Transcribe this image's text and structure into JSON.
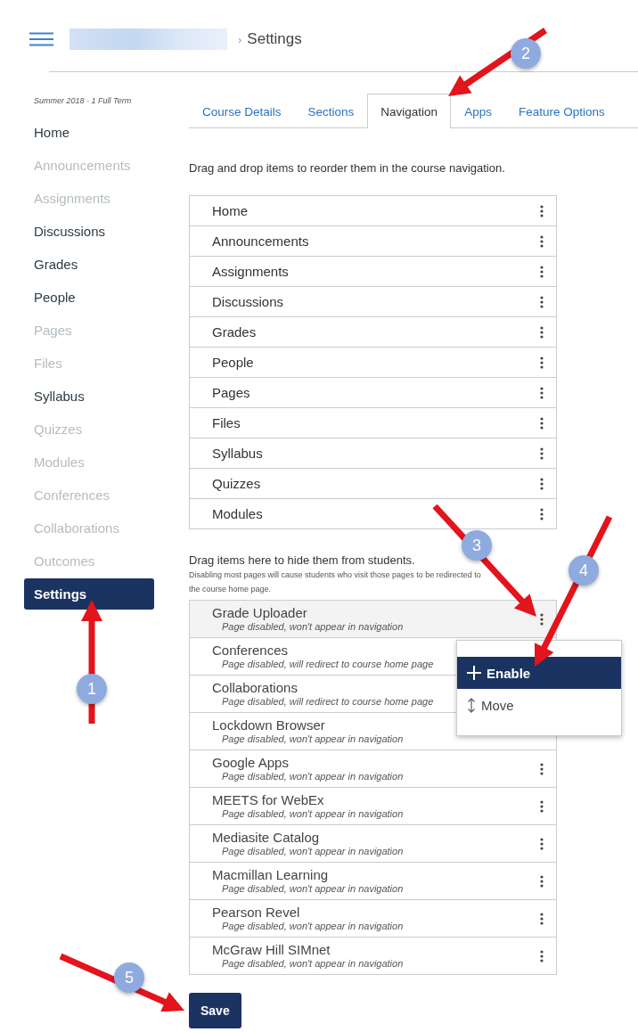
{
  "header": {
    "breadcrumb_separator": "›",
    "title": "Settings"
  },
  "sidebar": {
    "term": "Summer 2018 - 1 Full Term",
    "items": [
      {
        "label": "Home",
        "disabled": false,
        "selected": false
      },
      {
        "label": "Announcements",
        "disabled": true,
        "selected": false
      },
      {
        "label": "Assignments",
        "disabled": true,
        "selected": false
      },
      {
        "label": "Discussions",
        "disabled": false,
        "selected": false
      },
      {
        "label": "Grades",
        "disabled": false,
        "selected": false
      },
      {
        "label": "People",
        "disabled": false,
        "selected": false
      },
      {
        "label": "Pages",
        "disabled": true,
        "selected": false
      },
      {
        "label": "Files",
        "disabled": true,
        "selected": false
      },
      {
        "label": "Syllabus",
        "disabled": false,
        "selected": false
      },
      {
        "label": "Quizzes",
        "disabled": true,
        "selected": false
      },
      {
        "label": "Modules",
        "disabled": true,
        "selected": false
      },
      {
        "label": "Conferences",
        "disabled": true,
        "selected": false
      },
      {
        "label": "Collaborations",
        "disabled": true,
        "selected": false
      },
      {
        "label": "Outcomes",
        "disabled": true,
        "selected": false
      },
      {
        "label": "Settings",
        "disabled": false,
        "selected": true
      }
    ]
  },
  "tabs": [
    {
      "label": "Course Details",
      "selected": false
    },
    {
      "label": "Sections",
      "selected": false
    },
    {
      "label": "Navigation",
      "selected": true
    },
    {
      "label": "Apps",
      "selected": false
    },
    {
      "label": "Feature Options",
      "selected": false
    }
  ],
  "enabled_section": {
    "instruction": "Drag and drop items to reorder them in the course navigation.",
    "items": [
      {
        "label": "Home"
      },
      {
        "label": "Announcements"
      },
      {
        "label": "Assignments"
      },
      {
        "label": "Discussions"
      },
      {
        "label": "Grades"
      },
      {
        "label": "People"
      },
      {
        "label": "Pages"
      },
      {
        "label": "Files"
      },
      {
        "label": "Syllabus"
      },
      {
        "label": "Quizzes"
      },
      {
        "label": "Modules"
      }
    ]
  },
  "hidden_section": {
    "instruction": "Drag items here to hide them from students.",
    "note": "Disabling most pages will cause students who visit those pages to be redirected to the course home page.",
    "items": [
      {
        "label": "Grade Uploader",
        "status": "Page disabled, won't appear in navigation",
        "selected": true,
        "menu_button": true
      },
      {
        "label": "Conferences",
        "status": "Page disabled, will redirect to course home page",
        "selected": false,
        "menu_button": false
      },
      {
        "label": "Collaborations",
        "status": "Page disabled, will redirect to course home page",
        "selected": false,
        "menu_button": false
      },
      {
        "label": "Lockdown Browser",
        "status": "Page disabled, won't appear in navigation",
        "selected": false,
        "menu_button": false
      },
      {
        "label": "Google Apps",
        "status": "Page disabled, won't appear in navigation",
        "selected": false,
        "menu_button": true
      },
      {
        "label": "MEETS for WebEx",
        "status": "Page disabled, won't appear in navigation",
        "selected": false,
        "menu_button": true
      },
      {
        "label": "Mediasite Catalog",
        "status": "Page disabled, won't appear in navigation",
        "selected": false,
        "menu_button": true
      },
      {
        "label": "Macmillan Learning",
        "status": "Page disabled, won't appear in navigation",
        "selected": false,
        "menu_button": true
      },
      {
        "label": "Pearson Revel",
        "status": "Page disabled, won't appear in navigation",
        "selected": false,
        "menu_button": true
      },
      {
        "label": "McGraw Hill SIMnet",
        "status": "Page disabled, won't appear in navigation",
        "selected": false,
        "menu_button": true
      }
    ]
  },
  "context_menu": {
    "items": [
      {
        "kind": "plus",
        "label": "Enable",
        "selected": true
      },
      {
        "kind": "move",
        "label": "Move",
        "selected": false
      }
    ]
  },
  "save_button": {
    "label": "Save"
  },
  "annotations": [
    {
      "label": "1"
    },
    {
      "label": "2"
    },
    {
      "label": "3"
    },
    {
      "label": "4"
    },
    {
      "label": "5"
    }
  ]
}
